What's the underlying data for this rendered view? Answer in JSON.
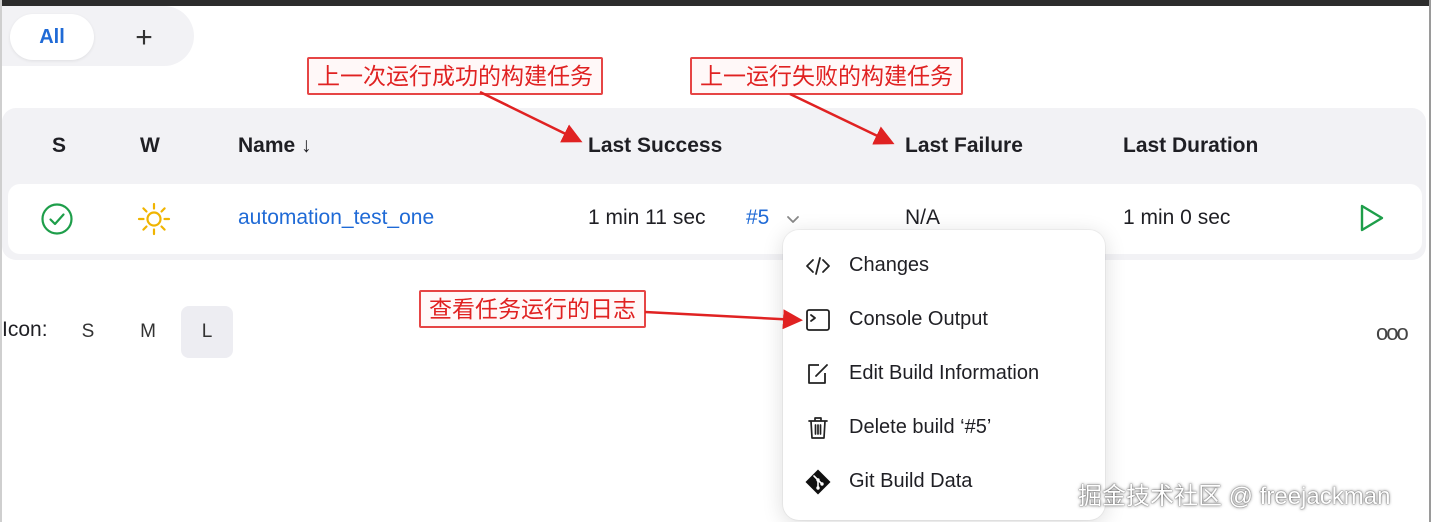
{
  "view_tabs": {
    "all_label": "All",
    "add_label": "+"
  },
  "table": {
    "headers": {
      "s": "S",
      "w": "W",
      "name": "Name ↓",
      "last_success": "Last Success",
      "last_failure": "Last Failure",
      "last_duration": "Last Duration"
    },
    "row": {
      "status": "success",
      "status_icon": "check-circle-icon",
      "weather_icon": "sun-icon",
      "job_name": "automation_test_one",
      "last_success_time": "1 min 11 sec",
      "last_success_build": "#5",
      "last_failure": "N/A",
      "last_duration": "1 min 0 sec"
    }
  },
  "icon_size": {
    "label": "Icon:",
    "options": [
      "S",
      "M",
      "L"
    ],
    "selected": "L"
  },
  "more_label": "ooo",
  "build_menu": {
    "items": [
      {
        "label": "Changes",
        "icon": "code-icon"
      },
      {
        "label": "Console Output",
        "icon": "terminal-icon"
      },
      {
        "label": "Edit Build Information",
        "icon": "edit-icon"
      },
      {
        "label": "Delete build ‘#5’",
        "icon": "trash-icon"
      },
      {
        "label": "Git Build Data",
        "icon": "git-icon"
      }
    ]
  },
  "annotations": {
    "last_success": "上一次运行成功的构建任务",
    "last_failure": "上一运行失败的构建任务",
    "console": "查看任务运行的日志"
  },
  "watermark": "掘金技术社区 @ freejackman",
  "colors": {
    "accent": "#1f6ad6",
    "success": "#1e9e4a",
    "weather": "#f0b400",
    "annotation": "#e02222"
  }
}
